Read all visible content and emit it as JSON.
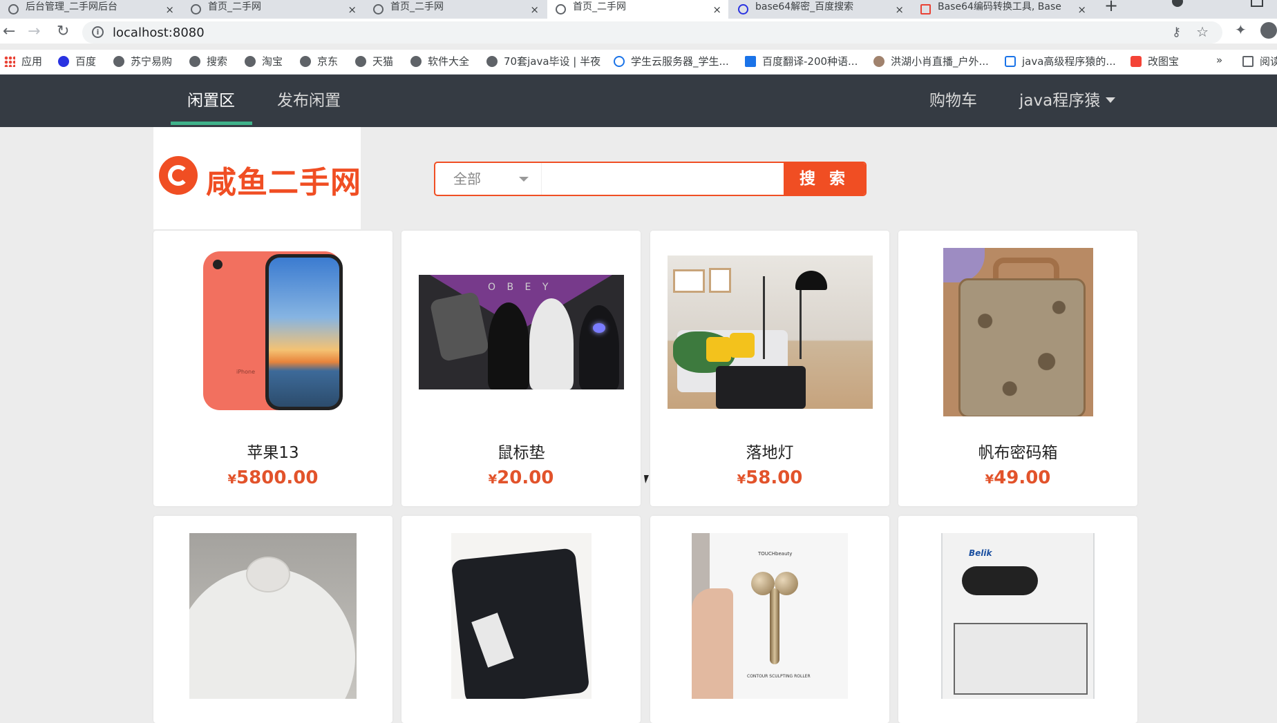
{
  "browser": {
    "tabs": [
      {
        "label": "后台管理_二手网后台"
      },
      {
        "label": "首页_二手网"
      },
      {
        "label": "首页_二手网"
      },
      {
        "label": "首页_二手网"
      },
      {
        "label": "base64解密_百度搜索"
      },
      {
        "label": "Base64编码转换工具, Base"
      }
    ],
    "new_tab": "+",
    "close_glyph": "×",
    "url": "localhost:8080",
    "bookmarks": [
      {
        "label": "应用",
        "icon": "apps-grid-icon"
      },
      {
        "label": "百度",
        "icon": "baidu-paw-icon"
      },
      {
        "label": "苏宁易购",
        "icon": "globe-icon"
      },
      {
        "label": "搜索",
        "icon": "globe-icon"
      },
      {
        "label": "淘宝",
        "icon": "globe-icon"
      },
      {
        "label": "京东",
        "icon": "globe-icon"
      },
      {
        "label": "天猫",
        "icon": "globe-icon"
      },
      {
        "label": "软件大全",
        "icon": "globe-icon"
      },
      {
        "label": "70套java毕设 | 半夜",
        "icon": "globe-icon"
      },
      {
        "label": "学生云服务器_学生...",
        "icon": "cloud-icon"
      },
      {
        "label": "百度翻译-200种语...",
        "icon": "translate-icon"
      },
      {
        "label": "洪湖小肖直播_户外...",
        "icon": "feather-icon"
      },
      {
        "label": "java高级程序猿的...",
        "icon": "bilibili-icon"
      },
      {
        "label": "改图宝",
        "icon": "gaitubao-icon"
      }
    ],
    "more_bookmarks": "»",
    "reading_list": "阅读"
  },
  "site_nav": {
    "items": [
      {
        "label": "闲置区",
        "active": true
      },
      {
        "label": "发布闲置",
        "active": false
      }
    ],
    "cart": "购物车",
    "user": "java程序猿",
    "accent": "#3fb28a",
    "background": "#353b43"
  },
  "logo": {
    "text": "咸鱼二手网",
    "color": "#f04e23"
  },
  "search": {
    "category": "全部",
    "placeholder": "",
    "button": "搜 索"
  },
  "products": [
    {
      "name": "苹果13",
      "currency": "¥",
      "price": "5800.00"
    },
    {
      "name": "鼠标垫",
      "currency": "¥",
      "price": "20.00"
    },
    {
      "name": "落地灯",
      "currency": "¥",
      "price": "58.00"
    },
    {
      "name": "帆布密码箱",
      "currency": "¥",
      "price": "49.00"
    },
    {
      "name": "",
      "currency": "",
      "price": ""
    },
    {
      "name": "",
      "currency": "",
      "price": ""
    },
    {
      "name": "",
      "currency": "",
      "price": ""
    },
    {
      "name": "",
      "currency": "",
      "price": ""
    }
  ],
  "image_text": {
    "pad_banner": "O B E Y",
    "phone_brand": "iPhone",
    "roller_brand": "TOUCHbeauty",
    "roller_caption": "CONTOUR SCULPTING ROLLER",
    "eye_brand": "Belik"
  },
  "colors": {
    "price": "#e2532b",
    "search_border": "#f04e23"
  }
}
